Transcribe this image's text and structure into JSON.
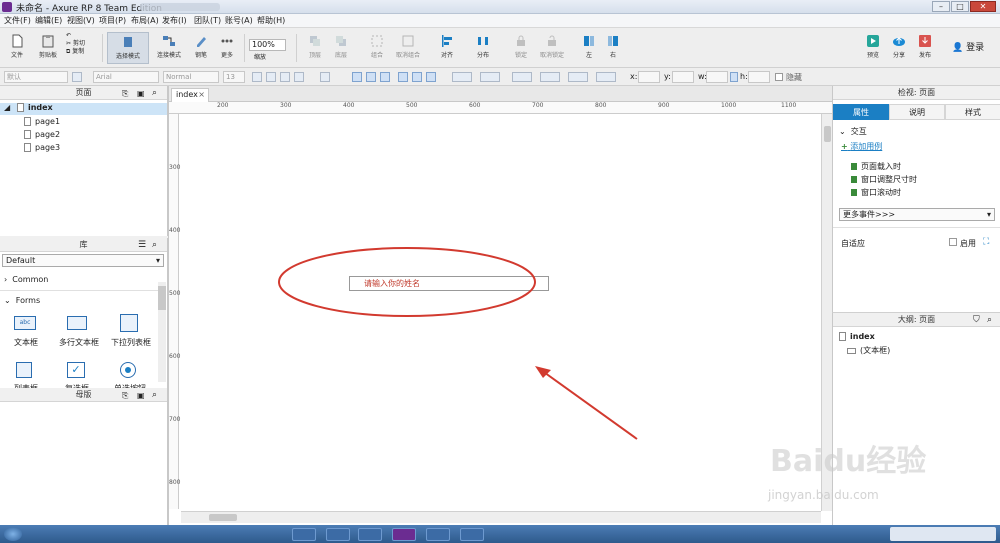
{
  "window": {
    "title": "未命名 - Axure RP 8 Team Edition"
  },
  "menu": [
    "文件(F)",
    "编辑(E)",
    "视图(V)",
    "项目(P)",
    "布局(A)",
    "发布(I)",
    "团队(T)",
    "账号(A)",
    "帮助(H)"
  ],
  "toolbar": {
    "file": "文件",
    "clipboard": "剪贴板",
    "select_mode": "选择模式",
    "connect_mode": "连接模式",
    "pen": "钢笔",
    "more": "更多",
    "zoom": "100%",
    "zoom_label": "缩放",
    "top": "顶层",
    "bottom": "底层",
    "group": "组合",
    "ungroup": "取消组合",
    "align": "对齐",
    "distribute": "分布",
    "lock": "锁定",
    "unlock": "取消锁定",
    "left": "左",
    "right": "右",
    "preview": "预览",
    "share": "分享",
    "publish": "发布",
    "login": "登录",
    "cut": "剪切",
    "copy": "复制"
  },
  "format": {
    "style": "默认",
    "font": "Arial",
    "weight": "Normal",
    "size": "13",
    "x_label": "x:",
    "y_label": "y:",
    "w_label": "w:",
    "h_label": "h:",
    "hidden": "隐藏"
  },
  "pages_panel": {
    "title": "页面",
    "root": "index",
    "children": [
      "page1",
      "page2",
      "page3"
    ]
  },
  "library_panel": {
    "title": "库",
    "dropdown": "Default",
    "section_common": "Common",
    "section_forms": "Forms",
    "widgets": [
      "文本框",
      "多行文本框",
      "下拉列表框",
      "列表框",
      "复选框",
      "单选按钮"
    ]
  },
  "masters_panel": {
    "title": "母版"
  },
  "canvas": {
    "tab": "index",
    "ruler_h": [
      "200",
      "300",
      "400",
      "500",
      "600",
      "700",
      "800",
      "900",
      "1000",
      "1100"
    ],
    "ruler_v": [
      "300",
      "400",
      "500",
      "600",
      "700",
      "800"
    ],
    "text_field_value": "请输入你的姓名"
  },
  "inspector": {
    "title": "检视: 页面",
    "tabs": [
      "属性",
      "说明",
      "样式"
    ],
    "section_interaction": "交互",
    "add_case": "添加用例",
    "events": [
      "页面载入时",
      "窗口调整尺寸时",
      "窗口滚动时"
    ],
    "more_events": "更多事件>>>",
    "adaptive": "自适应",
    "enable": "启用"
  },
  "outline": {
    "title": "大纲: 页面",
    "root": "index",
    "child": "(文本框)"
  },
  "watermark": {
    "text": "Baidu经验",
    "url": "jingyan.baidu.com"
  },
  "colors": {
    "accent": "#1b7fc4",
    "annotation": "#d23a2f"
  }
}
